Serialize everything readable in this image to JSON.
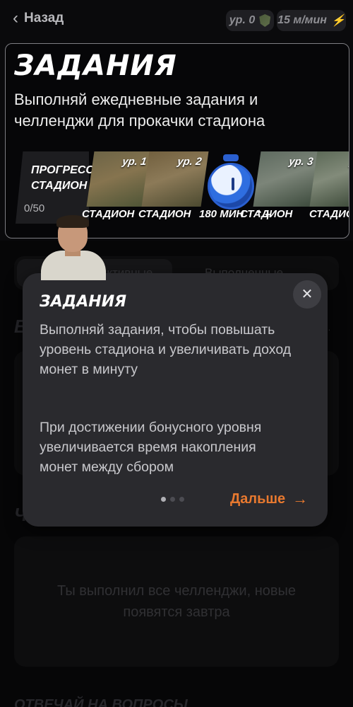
{
  "topbar": {
    "back_label": "Назад",
    "level_label": "ур. 0",
    "rate_label": "15 м/мин"
  },
  "header": {
    "title": "ЗАДАНИЯ",
    "subtitle": "Выполняй ежедневные задания и челленджи для прокачки стадиона",
    "progress_label_line1": "ПРОГРЕСС",
    "progress_label_line2": "СТАДИОН",
    "progress_count": "0/50",
    "tiles": [
      {
        "level": "ур. 1",
        "name": "СТАДИОН"
      },
      {
        "level": "ур. 2",
        "name": "СТАДИОН"
      },
      {
        "level": "ур. 3",
        "name": "СТАДИОН"
      },
      {
        "level": "у",
        "name": "СТАДИОН"
      }
    ],
    "bonus_label": "180 МИН ⌃ +"
  },
  "background": {
    "tab_active": "Активные",
    "tab_done": "Выполненные",
    "section_letter": "Е",
    "section_hint": "и.",
    "challenges_letter": "Ч",
    "empty_challenges": "Ты выполнил все челленджи, новые появятся завтра",
    "bottom_heading": "ОТВЕЧАЙ НА ВОПРОСЫ"
  },
  "tooltip": {
    "title": "ЗАДАНИЯ",
    "paragraph1": "Выполняй задания, чтобы повышать уровень стадиона и увеличивать доход монет в минуту",
    "paragraph2": "При достижении бонусного уровня увеличивается время накопления монет между сбором",
    "next_label": "Дальше",
    "pages_total": 3,
    "page_current": 1
  },
  "colors": {
    "accent": "#e8792f",
    "tooltip_bg": "#2a2a2e",
    "page_bg": "#0a0a0c"
  },
  "icons": {
    "back": "chevron-left-icon",
    "level": "shield-icon",
    "rate": "lightning-icon",
    "close": "close-icon",
    "next": "arrow-right-icon",
    "bonus": "stopwatch-icon"
  }
}
